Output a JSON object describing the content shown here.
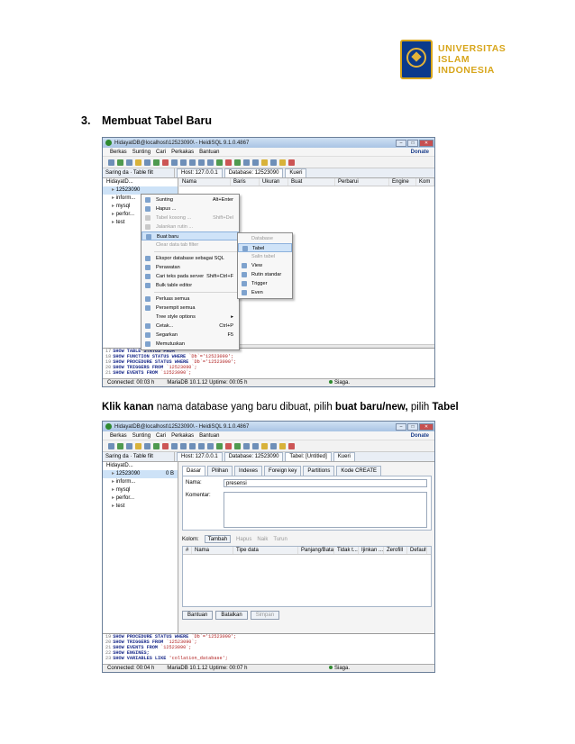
{
  "logo": {
    "line1": "UNIVERSITAS",
    "line2": "ISLAM",
    "line3": "INDONESIA"
  },
  "heading": {
    "number": "3.",
    "text": "Membuat Tabel Baru"
  },
  "caption": {
    "part1": "Klik kanan",
    "part2": " nama database yang baru dibuat, pilih ",
    "part3": "buat baru/new,",
    "part4": " pilih ",
    "part5": "Tabel"
  },
  "window1": {
    "title": "HidayatDB@localhost\\12523090\\ - HeidiSQL 9.1.0.4867",
    "menu": [
      "Berkas",
      "Sunting",
      "Cari",
      "Perkakas",
      "Bantuan"
    ],
    "donate": "Donate",
    "filter_label": "Saring da",
    "table_filter": "Table filt",
    "tabs": [
      "Host: 127.0.0.1",
      "Database: 12523090",
      "Kueri"
    ],
    "tree": [
      "HidayatD...",
      "12523090",
      "inform...",
      "mysql",
      "perfor...",
      "test"
    ],
    "grid_headers": [
      "Nama",
      "Baris",
      "Ukuran",
      "Buat",
      "Perbarui",
      "Engine",
      "Kom"
    ],
    "context_menu": [
      {
        "label": "Sunting",
        "shortcut": "Alt+Enter"
      },
      {
        "label": "Hapus ...",
        "shortcut": ""
      },
      {
        "label": "Tabel kosong ...",
        "shortcut": "Shift+Del"
      },
      {
        "label": "Jalankan rutin ...",
        "shortcut": ""
      },
      {
        "label": "Buat baru",
        "shortcut": ""
      },
      {
        "label": "Clear data tab filter",
        "shortcut": ""
      },
      {
        "label": "Ekspor database sebagai SQL",
        "shortcut": ""
      },
      {
        "label": "Perawatan",
        "shortcut": ""
      },
      {
        "label": "Cari teks pada server",
        "shortcut": "Shift+Ctrl+F"
      },
      {
        "label": "Bulk table editor",
        "shortcut": ""
      },
      {
        "label": "Perluas semua",
        "shortcut": ""
      },
      {
        "label": "Persempit semua",
        "shortcut": ""
      },
      {
        "label": "Tree style options",
        "shortcut": ""
      },
      {
        "label": "Cetak...",
        "shortcut": "Ctrl+P"
      },
      {
        "label": "Segarkan",
        "shortcut": "F5"
      },
      {
        "label": "Memutuskan",
        "shortcut": ""
      }
    ],
    "submenu": [
      "Database",
      "Tabel",
      "Salin tabel",
      "View",
      "Rutin standar",
      "Trigger",
      "Even"
    ],
    "sql_log": [
      {
        "n": "17",
        "kw": "SHOW TABLE STATUS FROM",
        "str": ""
      },
      {
        "n": "18",
        "kw": "SHOW FUNCTION STATUS WHERE",
        "str": "`Db`='12523090';"
      },
      {
        "n": "19",
        "kw": "SHOW PROCEDURE STATUS WHERE",
        "str": "`Db`='12523090';"
      },
      {
        "n": "20",
        "kw": "SHOW TRIGGERS FROM",
        "str": "`12523090`;"
      },
      {
        "n": "21",
        "kw": "SHOW EVENTS FROM",
        "str": "`12523090`;"
      }
    ],
    "status": {
      "connected": "Connected: 00:03 h",
      "server": "MariaDB 10.1.12 Uptime: 00:05 h",
      "ready": "Siaga."
    }
  },
  "window2": {
    "title": "HidayatDB@localhost\\12523090\\ - HeidiSQL 9.1.0.4867",
    "menu": [
      "Berkas",
      "Sunting",
      "Cari",
      "Perkakas",
      "Bantuan"
    ],
    "donate": "Donate",
    "filter_label": "Saring da",
    "table_filter": "Table filt",
    "tabs": [
      "Host: 127.0.0.1",
      "Database: 12523090",
      "Tabel: [Untitled]",
      "Kueri"
    ],
    "tree": [
      "HidayatD...",
      "12523090",
      "0 B",
      "inform...",
      "mysql",
      "perfor...",
      "test"
    ],
    "editor_tabs": [
      "Dasar",
      "Pilihan",
      "Indexes",
      "Foreign key",
      "Partitions",
      "Kode CREATE"
    ],
    "name_label": "Nama:",
    "name_value": "presensi",
    "comment_label": "Komentar:",
    "columns_label": "Kolom:",
    "col_buttons": [
      "Tambah",
      "Hapus",
      "Naik",
      "Turun"
    ],
    "col_headers": [
      "#",
      "Nama",
      "Tipe data",
      "Panjang/Batas",
      "Tidak t...",
      "Ijinkan ...",
      "Zerofill",
      "Default"
    ],
    "buttons": [
      "Bantuan",
      "Batalkan",
      "Simpan"
    ],
    "sql_log": [
      {
        "n": "19",
        "kw": "SHOW PROCEDURE STATUS WHERE",
        "str": "`Db`='12523090';"
      },
      {
        "n": "20",
        "kw": "SHOW TRIGGERS FROM",
        "str": "`12523090`;"
      },
      {
        "n": "21",
        "kw": "SHOW EVENTS FROM",
        "str": "`12523090`;"
      },
      {
        "n": "22",
        "kw": "SHOW ENGINES;",
        "str": ""
      },
      {
        "n": "23",
        "kw": "SHOW VARIABLES LIKE",
        "str": "'collation_database';"
      }
    ],
    "status": {
      "connected": "Connected: 00:04 h",
      "server": "MariaDB 10.1.12 Uptime: 00:07 h",
      "ready": "Siaga."
    }
  }
}
